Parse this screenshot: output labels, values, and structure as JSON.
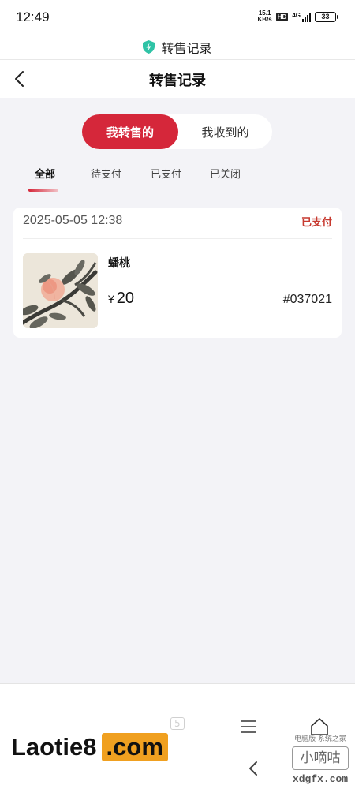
{
  "status_bar": {
    "time": "12:49",
    "net_speed_value": "15.1",
    "net_speed_unit": "KB/s",
    "hd": "HD",
    "network": "4G",
    "battery": "33"
  },
  "web_title_bar": {
    "icon": "shield-icon",
    "title": "转售记录"
  },
  "nav": {
    "title": "转售记录",
    "back_icon": "chevron-left-icon"
  },
  "segment": {
    "options": [
      "我转售的",
      "我收到的"
    ],
    "selected_index": 0
  },
  "tabs": {
    "items": [
      "全部",
      "待支付",
      "已支付",
      "已关闭"
    ],
    "active_index": 0
  },
  "orders": [
    {
      "time": "2025-05-05 12:38",
      "status": "已支付",
      "item_name": "蟠桃",
      "currency": "¥",
      "price": "20",
      "serial": "#037021"
    }
  ],
  "bottom_bar": {
    "menu_icon": "menu-icon",
    "home_icon": "home-icon",
    "back_icon": "chevron-left-icon",
    "ghost_count": "5"
  },
  "watermark": {
    "logo_part1": "Laotie8",
    "logo_part2": ".com",
    "right_small": "电脑版 系统之家",
    "right_box": "小嘀咕",
    "right_url": "xdgfx.com"
  },
  "colors": {
    "accent_red": "#d5273a",
    "status_paid": "#c7392f",
    "page_bg": "#f3f3f7"
  }
}
